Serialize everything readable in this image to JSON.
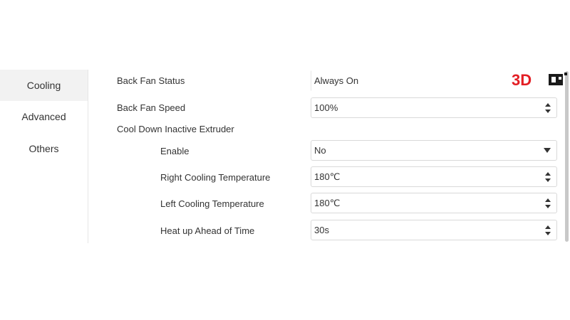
{
  "sidebar": {
    "items": [
      {
        "label": "Cooling",
        "active": true
      },
      {
        "label": "Advanced",
        "active": false
      },
      {
        "label": "Others",
        "active": false
      }
    ]
  },
  "settings": {
    "back_fan_status": {
      "label": "Back Fan Status",
      "value": "Always On"
    },
    "back_fan_speed": {
      "label": "Back Fan Speed",
      "value": "100%"
    },
    "cool_down_section": {
      "label": "Cool Down Inactive Extruder"
    },
    "enable": {
      "label": "Enable",
      "value": "No"
    },
    "right_cooling_temperature": {
      "label": "Right Cooling Temperature",
      "value": "180℃"
    },
    "left_cooling_temperature": {
      "label": "Left Cooling Temperature",
      "value": "180℃"
    },
    "heat_up_ahead": {
      "label": "Heat up Ahead of Time",
      "value": "30s"
    }
  },
  "watermark": {
    "text": "3DP",
    "colors": {
      "red": "#e31e24",
      "black": "#1a1a1a"
    }
  },
  "colors": {
    "sidebar_active_bg": "#f2f2f2",
    "border": "#d9d9d9",
    "text": "#333333"
  },
  "icons": {
    "stepper": "up-down-arrows-icon",
    "dropdown": "triangle-down-icon"
  }
}
